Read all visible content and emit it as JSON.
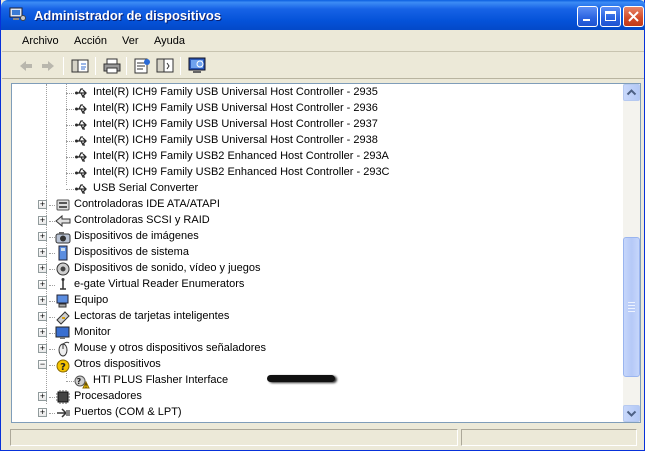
{
  "window": {
    "title": "Administrador de dispositivos"
  },
  "menu": [
    "Archivo",
    "Acción",
    "Ver",
    "Ayuda"
  ],
  "toolbar": {
    "buttons": [
      "back-icon",
      "forward-icon",
      "show-hide-tree-icon",
      "print-icon",
      "properties-icon",
      "help-icon",
      "scan-hardware-icon"
    ]
  },
  "tree": {
    "usb_children": [
      "Intel(R) ICH9 Family USB Universal Host Controller - 2935",
      "Intel(R) ICH9 Family USB Universal Host Controller - 2936",
      "Intel(R) ICH9 Family USB Universal Host Controller - 2937",
      "Intel(R) ICH9 Family USB Universal Host Controller - 2938",
      "Intel(R) ICH9 Family USB2 Enhanced Host Controller - 293A",
      "Intel(R) ICH9 Family USB2 Enhanced Host Controller - 293C",
      "USB Serial Converter"
    ],
    "categories": [
      {
        "label": "Controladoras IDE ATA/ATAPI",
        "expanded": false
      },
      {
        "label": "Controladoras SCSI y RAID",
        "expanded": false
      },
      {
        "label": "Dispositivos de imágenes",
        "expanded": false
      },
      {
        "label": "Dispositivos de sistema",
        "expanded": false
      },
      {
        "label": "Dispositivos de sonido, vídeo y juegos",
        "expanded": false
      },
      {
        "label": "e-gate Virtual Reader Enumerators",
        "expanded": false
      },
      {
        "label": "Equipo",
        "expanded": false
      },
      {
        "label": "Lectoras de tarjetas inteligentes",
        "expanded": false
      },
      {
        "label": "Monitor",
        "expanded": false
      },
      {
        "label": "Mouse y otros dispositivos señaladores",
        "expanded": false
      },
      {
        "label": "Otros dispositivos",
        "expanded": true
      },
      {
        "label": "Procesadores",
        "expanded": false
      },
      {
        "label": "Puertos (COM & LPT)",
        "expanded": false
      }
    ],
    "otros_child": "HTI PLUS Flasher Interface",
    "expander_collapsed": "+",
    "expander_expanded": "−"
  },
  "colors": {
    "titlebar": "#0452d8",
    "selection": "#316ac5",
    "warning": "#f5c400"
  }
}
